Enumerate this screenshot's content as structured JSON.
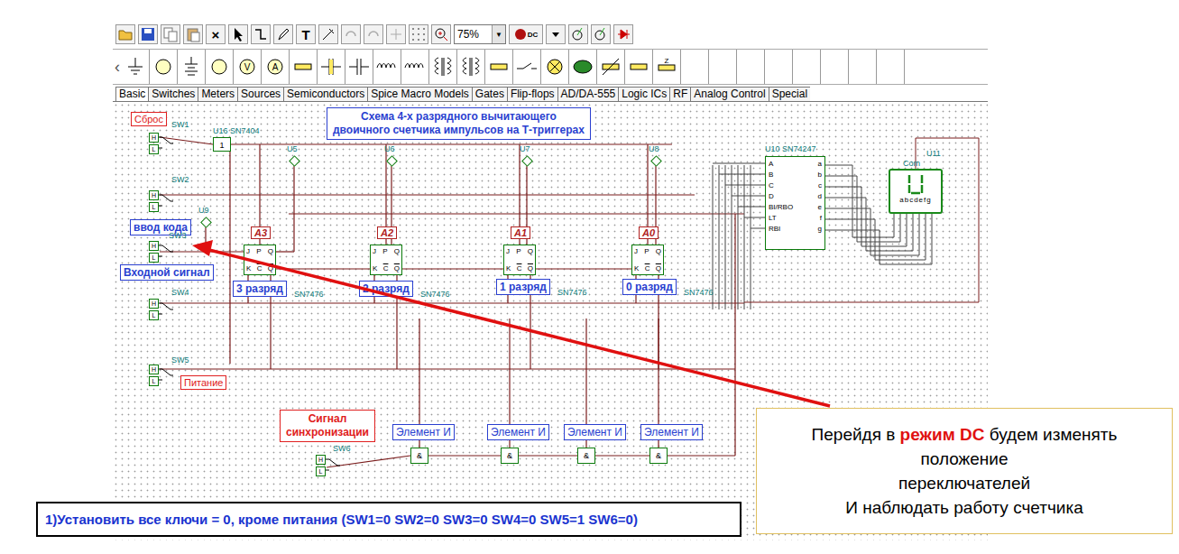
{
  "toolbar": {
    "row1": [
      {
        "kind": "open"
      },
      {
        "kind": "save"
      },
      {
        "kind": "copy"
      },
      {
        "kind": "paste"
      },
      {
        "kind": "glyph",
        "text": "×"
      },
      {
        "kind": "pointer"
      },
      {
        "kind": "wire"
      },
      {
        "kind": "pencil"
      },
      {
        "kind": "glyph",
        "text": "T"
      },
      {
        "kind": "probe"
      },
      {
        "kind": "undo"
      },
      {
        "kind": "redo"
      },
      {
        "kind": "junction"
      },
      {
        "kind": "grid"
      },
      {
        "kind": "zoom"
      },
      {
        "kind": "select",
        "text": "75%",
        "arrow": "▼"
      },
      {
        "kind": "dc",
        "text": "DC"
      },
      {
        "kind": "arrow-down"
      },
      {
        "kind": "meter"
      },
      {
        "kind": "meter2"
      },
      {
        "kind": "diode"
      }
    ],
    "scroll_left": "‹",
    "row2": [
      {
        "kind": "ground"
      },
      {
        "kind": "circle"
      },
      {
        "kind": "battery"
      },
      {
        "kind": "circle"
      },
      {
        "kind": "circle",
        "text": "V"
      },
      {
        "kind": "circle",
        "text": "A"
      },
      {
        "kind": "resistor"
      },
      {
        "kind": "cap-pol"
      },
      {
        "kind": "cap"
      },
      {
        "kind": "inductor"
      },
      {
        "kind": "inductor"
      },
      {
        "kind": "transformer"
      },
      {
        "kind": "transformer"
      },
      {
        "kind": "resistor"
      },
      {
        "kind": "switch"
      },
      {
        "kind": "cross-circle"
      },
      {
        "kind": "lamp"
      },
      {
        "kind": "varistor"
      },
      {
        "kind": "resistor"
      },
      {
        "kind": "zener",
        "text": "Z"
      },
      {
        "kind": "empty"
      },
      {
        "kind": "empty"
      },
      {
        "kind": "empty"
      },
      {
        "kind": "empty"
      },
      {
        "kind": "empty"
      },
      {
        "kind": "empty"
      },
      {
        "kind": "empty"
      },
      {
        "kind": "empty"
      }
    ]
  },
  "tabs": [
    {
      "label": "Basic",
      "selected": true
    },
    {
      "label": "Switches",
      "selected": false
    },
    {
      "label": "Meters",
      "selected": false
    },
    {
      "label": "Sources",
      "selected": false
    },
    {
      "label": "Semiconductors",
      "selected": false
    },
    {
      "label": "Spice Macro Models",
      "selected": false
    },
    {
      "label": "Gates",
      "selected": false
    },
    {
      "label": "Flip-flops",
      "selected": false
    },
    {
      "label": "AD/DA-555",
      "selected": false
    },
    {
      "label": "Logic ICs",
      "selected": false
    },
    {
      "label": "RF",
      "selected": false
    },
    {
      "label": "Analog Control",
      "selected": false
    },
    {
      "label": "Special",
      "selected": false
    }
  ],
  "diagram": {
    "title_lines": [
      "Схема 4-х разрядного вычитающего",
      "двоичного счетчика импульсов на Т-триггерах"
    ],
    "red_labels": [
      "Сброс",
      "Питание",
      "Сигнал синхронизации"
    ],
    "blue_labels": [
      "ввод кода",
      "Входной сигнал"
    ],
    "switches": [
      {
        "name": "SW1"
      },
      {
        "name": "SW2"
      },
      {
        "name": "SW3"
      },
      {
        "name": "SW4"
      },
      {
        "name": "SW5"
      },
      {
        "name": "SW6"
      }
    ],
    "switch_pins": [
      "H",
      "L"
    ],
    "inverter": {
      "name": "U16 SN7404",
      "symbol": "1"
    },
    "probes": [
      "U5",
      "U6",
      "U7",
      "U8",
      "U9"
    ],
    "flip_flops": [
      {
        "name": "A3",
        "caption": "3 разряд",
        "part": "SN7476"
      },
      {
        "name": "A2",
        "caption": "2 разряд",
        "part": "SN7476"
      },
      {
        "name": "A1",
        "caption": "1 разряд",
        "part": "SN7476"
      },
      {
        "name": "A0",
        "caption": "0 разряд",
        "part": "SN7476"
      }
    ],
    "ff_pins_top": [
      "J",
      "P",
      "Q"
    ],
    "ff_pins_bottom": [
      "K",
      "C",
      "Q"
    ],
    "gates": [
      {
        "caption": "Элемент И",
        "symbol": "&"
      },
      {
        "caption": "Элемент И",
        "symbol": "&"
      },
      {
        "caption": "Элемент И",
        "symbol": "&"
      },
      {
        "caption": "Элемент И",
        "symbol": "&"
      }
    ],
    "decoder": {
      "name": "U10 SN74247",
      "inputs": [
        "A",
        "B",
        "C",
        "D",
        "BI/RBO",
        "LT",
        "RBI"
      ],
      "outputs": [
        "a",
        "b",
        "c",
        "d",
        "e",
        "f",
        "g"
      ]
    },
    "display": {
      "name": "U11",
      "common": "Com",
      "pins": "abcdefg"
    }
  },
  "callout": {
    "lines": [
      [
        {
          "text": "Перейдя в ",
          "emphasis": false
        },
        {
          "text": "режим DC",
          "emphasis": true
        },
        {
          "text": " будем изменять",
          "emphasis": false
        }
      ],
      [
        {
          "text": "положение",
          "emphasis": false
        }
      ],
      [
        {
          "text": "переключателей",
          "emphasis": false
        }
      ],
      [
        {
          "text": "И наблюдать работу счетчика",
          "emphasis": false
        }
      ]
    ]
  },
  "instruction": "1)Установить все ключи = 0, кроме питания (SW1=0 SW2=0 SW3=0 SW4=0 SW5=1 SW6=0)"
}
